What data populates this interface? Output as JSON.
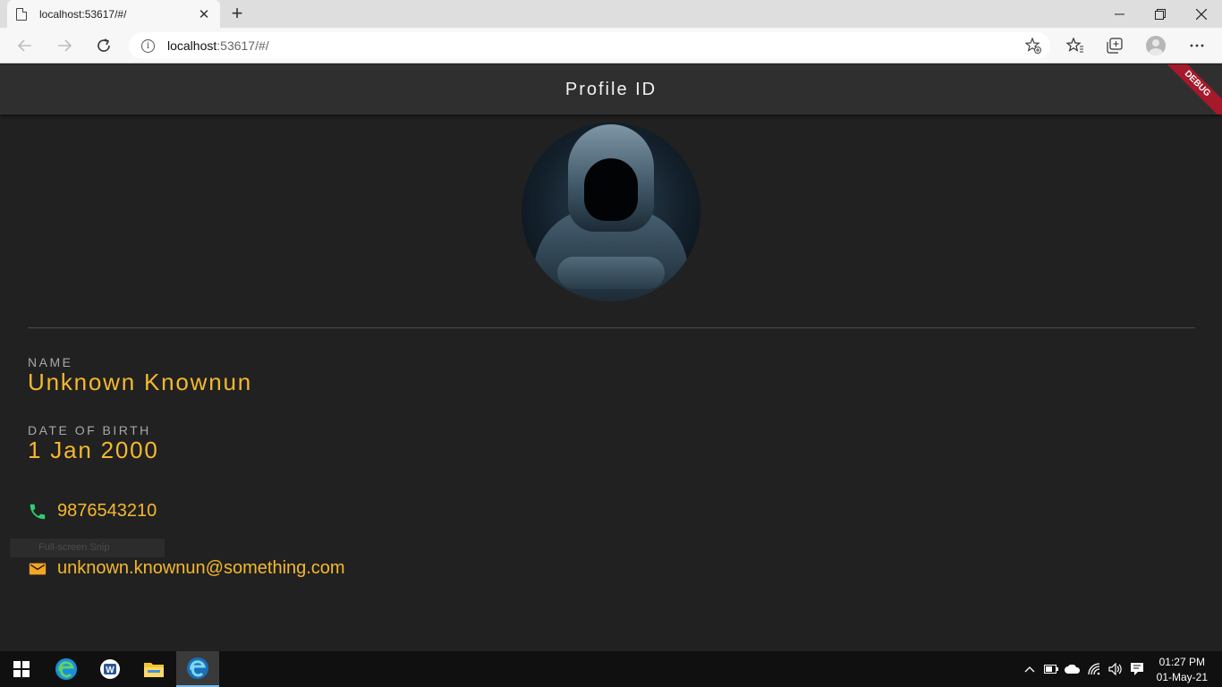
{
  "browser": {
    "tab_title": "localhost:53617/#/",
    "url_host": "localhost",
    "url_path": ":53617/#/"
  },
  "app": {
    "title": "Profile  ID",
    "debug_label": "DEBUG"
  },
  "profile": {
    "name_label": "NAME",
    "name_value": "Unknown Knownun",
    "dob_label": "DATE OF BIRTH",
    "dob_value": "1 Jan 2000",
    "phone": "9876543210",
    "email": "unknown.knownun@something.com"
  },
  "overlay": {
    "snip_label": "Full-screen Snip"
  },
  "colors": {
    "accent": "#f5b82e",
    "phone_icon": "#2ecc71",
    "email_icon": "#f5a623",
    "background": "#212121",
    "appbar": "#2f2f2f"
  },
  "taskbar": {
    "apps": [
      "edge-icon",
      "word-icon",
      "file-explorer-icon",
      "edge-dev-icon"
    ],
    "time": "01:27 PM",
    "date": "01-May-21"
  }
}
